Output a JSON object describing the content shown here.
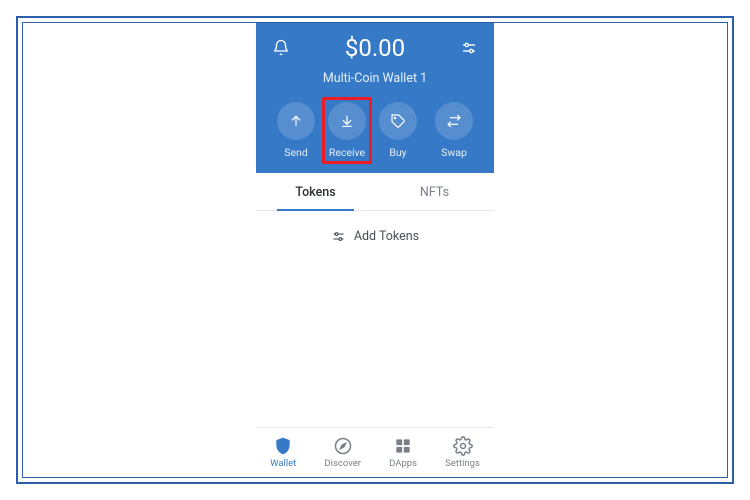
{
  "header": {
    "balance": "$0.00",
    "wallet_name": "Multi-Coin Wallet 1"
  },
  "actions": {
    "send": "Send",
    "receive": "Receive",
    "buy": "Buy",
    "swap": "Swap"
  },
  "tabs": {
    "tokens": "Tokens",
    "nfts": "NFTs"
  },
  "content": {
    "add_tokens": "Add Tokens"
  },
  "nav": {
    "wallet": "Wallet",
    "discover": "Discover",
    "dapps": "DApps",
    "settings": "Settings"
  },
  "colors": {
    "brand": "#3679c7",
    "highlight": "#ee1c25"
  }
}
